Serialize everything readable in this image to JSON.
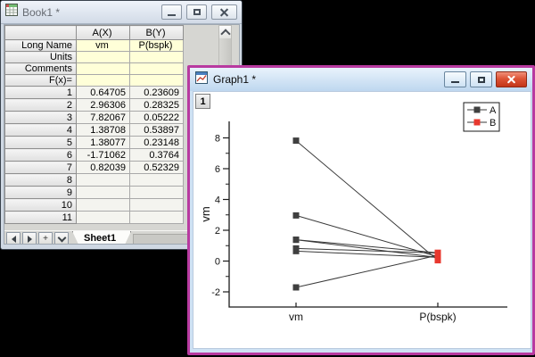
{
  "desktop": {
    "background_color": "#000000"
  },
  "book_window": {
    "title": "Book1 *",
    "window_controls": [
      "minimize",
      "maximize",
      "close"
    ],
    "columns": [
      "A(X)",
      "B(Y)"
    ],
    "header_rows": [
      {
        "label": "Long Name",
        "a": "vm",
        "b": "P(bspk)"
      },
      {
        "label": "Units",
        "a": "",
        "b": ""
      },
      {
        "label": "Comments",
        "a": "",
        "b": ""
      },
      {
        "label": "F(x)=",
        "a": "",
        "b": ""
      }
    ],
    "data_rows": [
      {
        "label": "1",
        "a": "0.64705",
        "b": "0.23609"
      },
      {
        "label": "2",
        "a": "2.96306",
        "b": "0.28325"
      },
      {
        "label": "3",
        "a": "7.82067",
        "b": "0.05222"
      },
      {
        "label": "4",
        "a": "1.38708",
        "b": "0.53897"
      },
      {
        "label": "5",
        "a": "1.38077",
        "b": "0.23148"
      },
      {
        "label": "6",
        "a": "-1.71062",
        "b": "0.3764"
      },
      {
        "label": "7",
        "a": "0.82039",
        "b": "0.52329"
      },
      {
        "label": "8",
        "a": "",
        "b": ""
      },
      {
        "label": "9",
        "a": "",
        "b": ""
      },
      {
        "label": "10",
        "a": "",
        "b": ""
      },
      {
        "label": "11",
        "a": "",
        "b": ""
      }
    ],
    "sheet_tab": "Sheet1",
    "nav_plus": "+",
    "header_fill_color": "#ffffd8"
  },
  "graph_window": {
    "title": "Graph1 *",
    "layer_button": "1",
    "border_color": "#b83aa0",
    "window_controls": [
      "minimize",
      "maximize",
      "close"
    ]
  },
  "chart_data": {
    "type": "line",
    "title": "",
    "categories": [
      "vm",
      "P(bspk)"
    ],
    "xlabel": "",
    "ylabel": "vm",
    "ylim": [
      -3,
      9
    ],
    "yticks": [
      8,
      6,
      4,
      2,
      0,
      -2
    ],
    "yminorticks": [
      7,
      5,
      3,
      1,
      -1
    ],
    "grid": false,
    "legend": {
      "position": "top-right",
      "entries": [
        "A",
        "B"
      ]
    },
    "line_color": "#3a3a3a",
    "pairing": "row-wise lines connect each A point at category vm to its B point at category P(bspk)",
    "series": [
      {
        "name": "A",
        "category": "vm",
        "marker": "square",
        "color": "#3f3f3f",
        "values": [
          0.64705,
          2.96306,
          7.82067,
          1.38708,
          1.38077,
          -1.71062,
          0.82039
        ]
      },
      {
        "name": "B",
        "category": "P(bspk)",
        "marker": "square",
        "color": "#e8382e",
        "values": [
          0.23609,
          0.28325,
          0.05222,
          0.53897,
          0.23148,
          0.3764,
          0.52329
        ]
      }
    ]
  }
}
